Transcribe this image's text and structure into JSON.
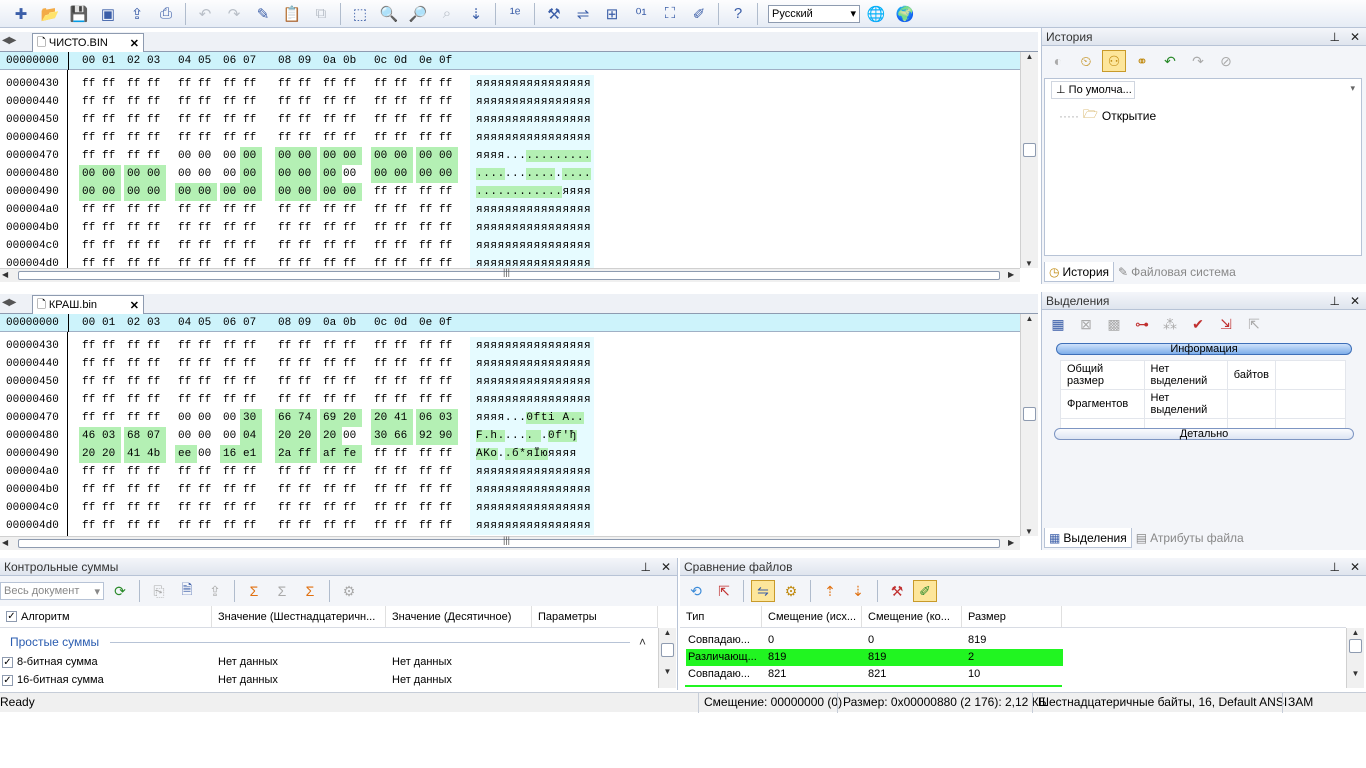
{
  "toolbar": {
    "language": "Русский",
    "icons": [
      "new-file-icon",
      "open-file-icon",
      "save-icon",
      "save-all-icon",
      "export-icon",
      "print-icon",
      "undo-icon",
      "redo-icon",
      "edit-icon",
      "paste-icon",
      "copy-icon",
      "select-icon",
      "zoom-icon",
      "find-icon",
      "find-next-icon",
      "goto-icon",
      "encoding-icon",
      "tools-icon",
      "compare-icon",
      "insert-icon",
      "binary-icon",
      "window-icon",
      "pencil-icon",
      "help-icon"
    ]
  },
  "editor1": {
    "tab": "ЧИСТО.BIN",
    "header_offset": "00000000",
    "header_cols": [
      "00",
      "01",
      "02",
      "03",
      "04",
      "05",
      "06",
      "07",
      "08",
      "09",
      "0a",
      "0b",
      "0c",
      "0d",
      "0e",
      "0f"
    ],
    "rows": [
      {
        "off": "00000430",
        "bytes": [
          "ff",
          "ff",
          "ff",
          "ff",
          "ff",
          "ff",
          "ff",
          "ff",
          "ff",
          "ff",
          "ff",
          "ff",
          "ff",
          "ff",
          "ff",
          "ff"
        ],
        "ascii": "яяяяяяяяяяяяяяяя"
      },
      {
        "off": "00000440",
        "bytes": [
          "ff",
          "ff",
          "ff",
          "ff",
          "ff",
          "ff",
          "ff",
          "ff",
          "ff",
          "ff",
          "ff",
          "ff",
          "ff",
          "ff",
          "ff",
          "ff"
        ],
        "ascii": "яяяяяяяяяяяяяяяя"
      },
      {
        "off": "00000450",
        "bytes": [
          "ff",
          "ff",
          "ff",
          "ff",
          "ff",
          "ff",
          "ff",
          "ff",
          "ff",
          "ff",
          "ff",
          "ff",
          "ff",
          "ff",
          "ff",
          "ff"
        ],
        "ascii": "яяяяяяяяяяяяяяяя"
      },
      {
        "off": "00000460",
        "bytes": [
          "ff",
          "ff",
          "ff",
          "ff",
          "ff",
          "ff",
          "ff",
          "ff",
          "ff",
          "ff",
          "ff",
          "ff",
          "ff",
          "ff",
          "ff",
          "ff"
        ],
        "ascii": "яяяяяяяяяяяяяяяя"
      },
      {
        "off": "00000470",
        "bytes": [
          "ff",
          "ff",
          "ff",
          "ff",
          "00",
          "00",
          "00",
          "00",
          "00",
          "00",
          "00",
          "00",
          "00",
          "00",
          "00",
          "00"
        ],
        "ascii": "яяяя............"
      },
      {
        "off": "00000480",
        "bytes": [
          "00",
          "00",
          "00",
          "00",
          "00",
          "00",
          "00",
          "00",
          "00",
          "00",
          "00",
          "00",
          "00",
          "00",
          "00",
          "00"
        ],
        "ascii": "................"
      },
      {
        "off": "00000490",
        "bytes": [
          "00",
          "00",
          "00",
          "00",
          "00",
          "00",
          "00",
          "00",
          "00",
          "00",
          "00",
          "00",
          "ff",
          "ff",
          "ff",
          "ff"
        ],
        "ascii": "............яяяя"
      },
      {
        "off": "000004a0",
        "bytes": [
          "ff",
          "ff",
          "ff",
          "ff",
          "ff",
          "ff",
          "ff",
          "ff",
          "ff",
          "ff",
          "ff",
          "ff",
          "ff",
          "ff",
          "ff",
          "ff"
        ],
        "ascii": "яяяяяяяяяяяяяяяя"
      },
      {
        "off": "000004b0",
        "bytes": [
          "ff",
          "ff",
          "ff",
          "ff",
          "ff",
          "ff",
          "ff",
          "ff",
          "ff",
          "ff",
          "ff",
          "ff",
          "ff",
          "ff",
          "ff",
          "ff"
        ],
        "ascii": "яяяяяяяяяяяяяяяя"
      },
      {
        "off": "000004c0",
        "bytes": [
          "ff",
          "ff",
          "ff",
          "ff",
          "ff",
          "ff",
          "ff",
          "ff",
          "ff",
          "ff",
          "ff",
          "ff",
          "ff",
          "ff",
          "ff",
          "ff"
        ],
        "ascii": "яяяяяяяяяяяяяяяя"
      },
      {
        "off": "000004d0",
        "bytes": [
          "ff",
          "ff",
          "ff",
          "ff",
          "ff",
          "ff",
          "ff",
          "ff",
          "ff",
          "ff",
          "ff",
          "ff",
          "ff",
          "ff",
          "ff",
          "ff"
        ],
        "ascii": "яяяяяяяяяяяяяяяя"
      }
    ]
  },
  "editor2": {
    "tab": "КРАШ.bin",
    "header_offset": "00000000",
    "header_cols": [
      "00",
      "01",
      "02",
      "03",
      "04",
      "05",
      "06",
      "07",
      "08",
      "09",
      "0a",
      "0b",
      "0c",
      "0d",
      "0e",
      "0f"
    ],
    "rows": [
      {
        "off": "00000430",
        "bytes": [
          "ff",
          "ff",
          "ff",
          "ff",
          "ff",
          "ff",
          "ff",
          "ff",
          "ff",
          "ff",
          "ff",
          "ff",
          "ff",
          "ff",
          "ff",
          "ff"
        ],
        "ascii": "яяяяяяяяяяяяяяяя"
      },
      {
        "off": "00000440",
        "bytes": [
          "ff",
          "ff",
          "ff",
          "ff",
          "ff",
          "ff",
          "ff",
          "ff",
          "ff",
          "ff",
          "ff",
          "ff",
          "ff",
          "ff",
          "ff",
          "ff"
        ],
        "ascii": "яяяяяяяяяяяяяяяя"
      },
      {
        "off": "00000450",
        "bytes": [
          "ff",
          "ff",
          "ff",
          "ff",
          "ff",
          "ff",
          "ff",
          "ff",
          "ff",
          "ff",
          "ff",
          "ff",
          "ff",
          "ff",
          "ff",
          "ff"
        ],
        "ascii": "яяяяяяяяяяяяяяяя"
      },
      {
        "off": "00000460",
        "bytes": [
          "ff",
          "ff",
          "ff",
          "ff",
          "ff",
          "ff",
          "ff",
          "ff",
          "ff",
          "ff",
          "ff",
          "ff",
          "ff",
          "ff",
          "ff",
          "ff"
        ],
        "ascii": "яяяяяяяяяяяяяяяя"
      },
      {
        "off": "00000470",
        "bytes": [
          "ff",
          "ff",
          "ff",
          "ff",
          "00",
          "00",
          "00",
          "30",
          "66",
          "74",
          "69",
          "20",
          "20",
          "41",
          "06",
          "03"
        ],
        "ascii": "яяяя...0fti  A.."
      },
      {
        "off": "00000480",
        "bytes": [
          "46",
          "03",
          "68",
          "07",
          "00",
          "00",
          "00",
          "04",
          "20",
          "20",
          "20",
          "00",
          "30",
          "66",
          "92",
          "90"
        ],
        "ascii": "F.h.....   .0f'ђ"
      },
      {
        "off": "00000490",
        "bytes": [
          "20",
          "20",
          "41",
          "4b",
          "ee",
          "00",
          "16",
          "e1",
          "2a",
          "ff",
          "af",
          "fe",
          "ff",
          "ff",
          "ff",
          "ff"
        ],
        "ascii": "  AKо..б*яЇюяяяя"
      },
      {
        "off": "000004a0",
        "bytes": [
          "ff",
          "ff",
          "ff",
          "ff",
          "ff",
          "ff",
          "ff",
          "ff",
          "ff",
          "ff",
          "ff",
          "ff",
          "ff",
          "ff",
          "ff",
          "ff"
        ],
        "ascii": "яяяяяяяяяяяяяяяя"
      },
      {
        "off": "000004b0",
        "bytes": [
          "ff",
          "ff",
          "ff",
          "ff",
          "ff",
          "ff",
          "ff",
          "ff",
          "ff",
          "ff",
          "ff",
          "ff",
          "ff",
          "ff",
          "ff",
          "ff"
        ],
        "ascii": "яяяяяяяяяяяяяяяя"
      },
      {
        "off": "000004c0",
        "bytes": [
          "ff",
          "ff",
          "ff",
          "ff",
          "ff",
          "ff",
          "ff",
          "ff",
          "ff",
          "ff",
          "ff",
          "ff",
          "ff",
          "ff",
          "ff",
          "ff"
        ],
        "ascii": "яяяяяяяяяяяяяяяя"
      },
      {
        "off": "000004d0",
        "bytes": [
          "ff",
          "ff",
          "ff",
          "ff",
          "ff",
          "ff",
          "ff",
          "ff",
          "ff",
          "ff",
          "ff",
          "ff",
          "ff",
          "ff",
          "ff",
          "ff"
        ],
        "ascii": "яяяяяяяяяяяяяяяя"
      }
    ]
  },
  "history": {
    "title": "История",
    "node_root": "По умолча...",
    "node_child": "Открытие",
    "tab_history": "История",
    "tab_fs": "Файловая система"
  },
  "selections": {
    "title": "Выделения",
    "info_button": "Информация",
    "rows": [
      {
        "name": "Общий размер",
        "value": "Нет выделений",
        "extra": "байтов"
      },
      {
        "name": "Фрагментов",
        "value": "Нет выделений",
        "extra": ""
      }
    ],
    "detail_button": "Детально",
    "tab_selections": "Выделения",
    "tab_attrs": "Атрибуты файла"
  },
  "checksums": {
    "title": "Контрольные суммы",
    "scope": "Весь документ",
    "columns": [
      "Алгоритм",
      "Значение (Шестнадцатеричн...",
      "Значение (Десятичное)",
      "Параметры"
    ],
    "group": "Простые суммы",
    "rows": [
      {
        "name": "8-битная сумма",
        "hex": "Нет данных",
        "dec": "Нет данных"
      },
      {
        "name": "16-битная сумма",
        "hex": "Нет данных",
        "dec": "Нет данных"
      }
    ]
  },
  "compare": {
    "title": "Сравнение файлов",
    "columns": [
      "Тип",
      "Смещение (исх...",
      "Смещение (ко...",
      "Размер"
    ],
    "rows": [
      {
        "type": "Совпадаю...",
        "src": "0",
        "dst": "0",
        "size": "819",
        "diff": false
      },
      {
        "type": "Различающ...",
        "src": "819",
        "dst": "819",
        "size": "2",
        "diff": true
      },
      {
        "type": "Совпадаю...",
        "src": "821",
        "dst": "821",
        "size": "10",
        "diff": false
      }
    ]
  },
  "status": {
    "ready": "Ready",
    "offset": "Смещение: 00000000 (0)",
    "size": "Размер: 0x00000880 (2 176): 2,12 КБ",
    "mode": "Шестнадцатеричные байты, 16, Default ANSI",
    "insert": "ЗАМ"
  },
  "colors": {
    "diff_green": "#b4f0b4",
    "compare_green": "#21f521",
    "header_cyan": "#cdf3fb"
  }
}
